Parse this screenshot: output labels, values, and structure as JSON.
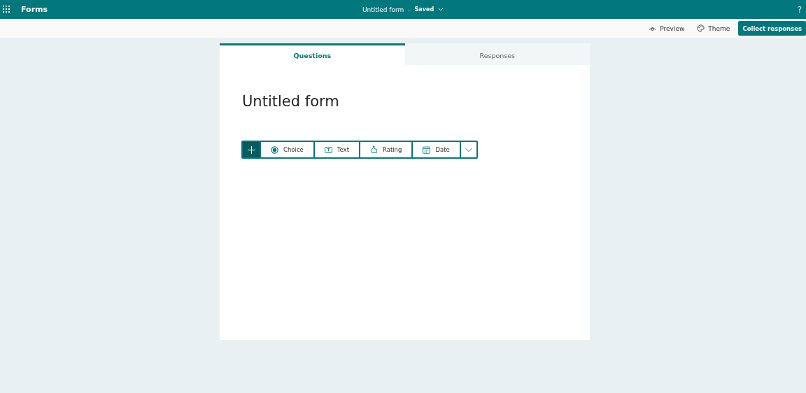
{
  "app_bar": {
    "app_name": "Forms",
    "document_title": "Untitled form",
    "separator": "-",
    "save_status": "Saved",
    "help": "?"
  },
  "command_bar": {
    "preview": "Preview",
    "theme": "Theme",
    "collect": "Collect responses"
  },
  "tabs": [
    {
      "label": "Questions",
      "selected": true
    },
    {
      "label": "Responses",
      "selected": false
    }
  ],
  "form": {
    "title": "Untitled form"
  },
  "question_types": [
    {
      "kind": "choice",
      "label": "Choice"
    },
    {
      "kind": "text",
      "label": "Text"
    },
    {
      "kind": "rating",
      "label": "Rating"
    },
    {
      "kind": "date",
      "label": "Date"
    }
  ]
}
